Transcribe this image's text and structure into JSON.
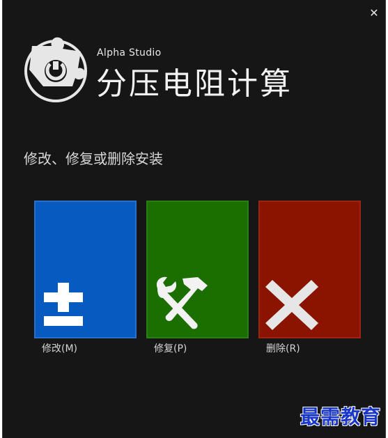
{
  "window": {
    "close_icon": "close-icon",
    "close_glyph": "✕",
    "brand": "Alpha Studio",
    "title": "分压电阻计算",
    "subtitle": "修改、修复或删除安装"
  },
  "options": [
    {
      "label": "修改(M)",
      "icon": "plus-minus-icon",
      "color": "#075bc0"
    },
    {
      "label": "修复(P)",
      "icon": "wrench-hammer-icon",
      "color": "#1b6e00"
    },
    {
      "label": "删除(R)",
      "icon": "close-x-icon",
      "color": "#8b1400"
    }
  ],
  "watermark": {
    "text": "最需教育"
  },
  "colors": {
    "background": "#161616",
    "text": "#f2f2f2",
    "watermark": "#1a36c9"
  }
}
